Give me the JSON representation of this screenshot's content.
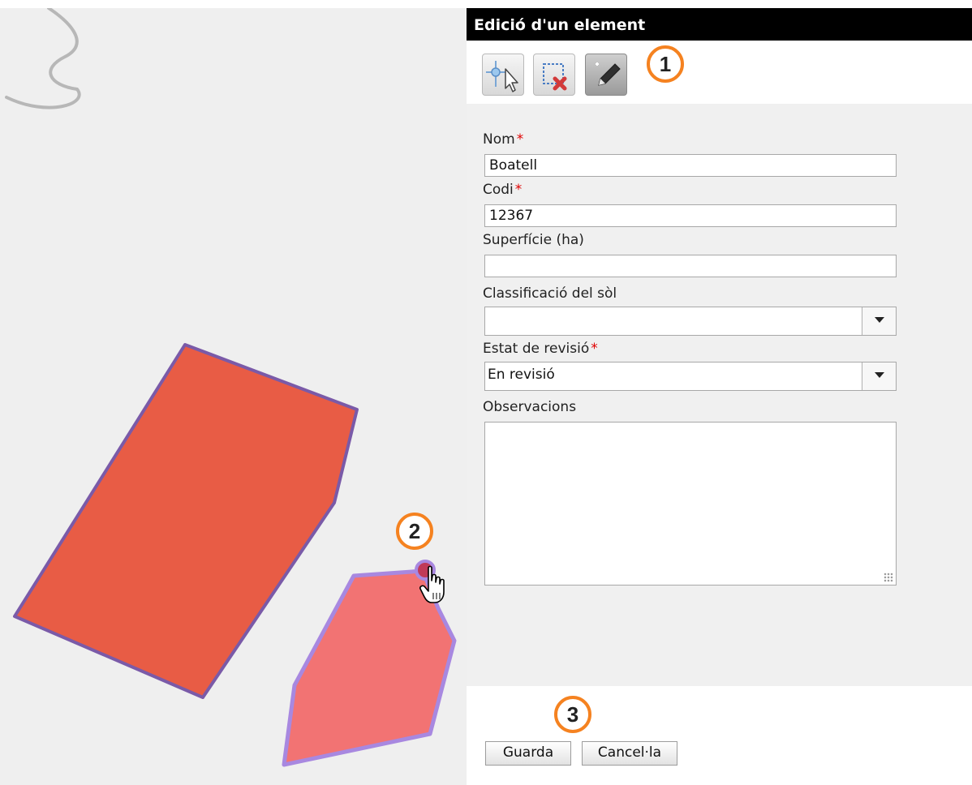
{
  "panel": {
    "title": "Edició d'un element",
    "toolbar": {
      "tools": [
        {
          "name": "select-move-tool",
          "icon": "move-vertex-icon"
        },
        {
          "name": "delete-tool",
          "icon": "delete-selection-icon"
        },
        {
          "name": "draw-tool",
          "icon": "pencil-icon",
          "active": true
        }
      ]
    },
    "fields": {
      "nom": {
        "label": "Nom",
        "required": "*",
        "value": "Boatell"
      },
      "codi": {
        "label": "Codi",
        "required": "*",
        "value": "12367"
      },
      "superficie": {
        "label": "Superfície (ha)",
        "value": ""
      },
      "classificacio": {
        "label": "Classificació del sòl",
        "value": ""
      },
      "estat": {
        "label": "Estat de revisió",
        "required": "*",
        "value": "En revisió"
      },
      "observacions": {
        "label": "Observacions",
        "value": ""
      }
    },
    "buttons": {
      "save": "Guarda",
      "cancel": "Cancel·la"
    }
  },
  "callouts": {
    "one": "1",
    "two": "2",
    "three": "3"
  },
  "colors": {
    "polygon_main": "#e85c45",
    "polygon_edit": "#f27373",
    "polygon_stroke": "#7a5aa8",
    "edit_stroke": "#a888e0",
    "callout": "#f58220",
    "line_feature": "#b7b7b7"
  }
}
